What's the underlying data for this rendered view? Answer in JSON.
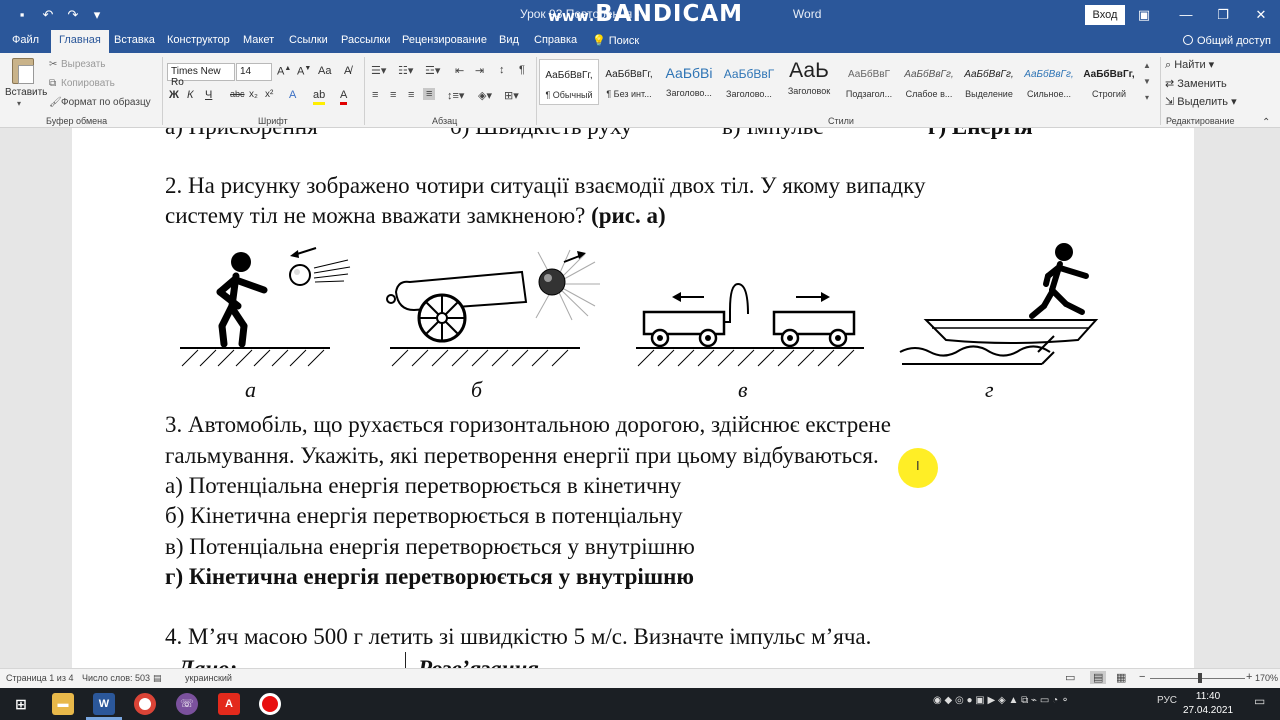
{
  "titlebar": {
    "doc_title": "Урок 93 Повторення",
    "title_suffix": "Word",
    "watermark": "BANDICAM",
    "watermark_prefix": "www.",
    "login_label": "Вход"
  },
  "tabs": [
    {
      "label": "Файл"
    },
    {
      "label": "Главная"
    },
    {
      "label": "Вставка"
    },
    {
      "label": "Конструктор"
    },
    {
      "label": "Макет"
    },
    {
      "label": "Ссылки"
    },
    {
      "label": "Рассылки"
    },
    {
      "label": "Рецензирование"
    },
    {
      "label": "Вид"
    },
    {
      "label": "Справка"
    },
    {
      "label": "Поиск"
    }
  ],
  "share_label": "Общий доступ",
  "ribbon": {
    "clipboard": {
      "paste": "Вставить",
      "cut": "Вырезать",
      "copy": "Копировать",
      "format_painter": "Формат по образцу",
      "group": "Буфер обмена"
    },
    "font": {
      "name": "Times New Ro",
      "size": "14",
      "group": "Шрифт"
    },
    "paragraph": {
      "group": "Абзац"
    },
    "styles": {
      "group": "Стили",
      "items": [
        {
          "sample": "АаБбВвГг,",
          "name": "¶ Обычный"
        },
        {
          "sample": "АаБбВвГг,",
          "name": "¶ Без инт..."
        },
        {
          "sample": "АаБбВі",
          "name": "Заголово..."
        },
        {
          "sample": "АаБбВвГ",
          "name": "Заголово..."
        },
        {
          "sample": "АаЬ",
          "name": "Заголовок"
        },
        {
          "sample": "АаБбВвГ",
          "name": "Подзагол..."
        },
        {
          "sample": "АаБбВвГг,",
          "name": "Слабое в..."
        },
        {
          "sample": "АаБбВвГг,",
          "name": "Выделение"
        },
        {
          "sample": "АаБбВвГг,",
          "name": "Сильное..."
        },
        {
          "sample": "АаБбВвГг,",
          "name": "Строгий"
        }
      ]
    },
    "editing": {
      "find": "Найти",
      "replace": "Заменить",
      "select": "Выделить",
      "group": "Редактирование"
    }
  },
  "document": {
    "cut_top": {
      "a": "а) Прискорення",
      "b": "б) Швидкість руху",
      "v": "в) Імпульс",
      "g": "г) Енергія"
    },
    "q2_line1": "2.   На рисунку зображено чотири ситуації взаємодії двох тіл. У якому випадку",
    "q2_line2": "систему тіл не можна вважати замкненою?",
    "q2_ref": "(рис. а)",
    "captions": [
      "а",
      "б",
      "в",
      "г"
    ],
    "q3_line1": "3.  Автомобіль,  що  рухається  горизонтальною  дорогою,  здійснює  екстрене",
    "q3_line2": "гальмування. Укажіть, які перетворення енергії при цьому відбуваються.",
    "q3_opt_a": "а) Потенціальна енергія перетворюється в кінетичну",
    "q3_opt_b": "б) Кінетична енергія перетворюється в потенціальну",
    "q3_opt_v": "в) Потенціальна енергія перетворюється у внутрішню",
    "q3_opt_g": "г) Кінетична енергія перетворюється у внутрішню",
    "q4_line": "4. М’яч масою 500 г летить зі швидкістю 5 м/с. Визначте імпульс м’яча.",
    "given": "Дано:",
    "solution": "Розв’язання"
  },
  "statusbar": {
    "page": "Страница 1 из 4",
    "words": "Число слов: 503",
    "language": "украинский",
    "zoom": "170%"
  },
  "taskbar": {
    "lang": "РУС",
    "time": "11:40",
    "date": "27.04.2021"
  },
  "colors": {
    "word_blue": "#2b579a",
    "ribbon_bg": "#f3f3f3",
    "highlight": "#ffeb00"
  }
}
